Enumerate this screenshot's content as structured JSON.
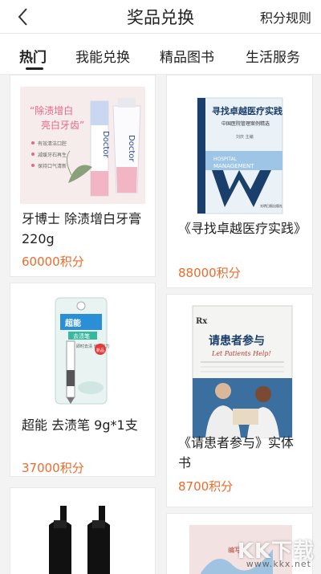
{
  "header": {
    "title": "奖品兑换",
    "rules_label": "积分规则"
  },
  "tabs": [
    {
      "label": "热门"
    },
    {
      "label": "我能兑换"
    },
    {
      "label": "精品图书"
    },
    {
      "label": "生活服务"
    }
  ],
  "products": [
    {
      "name": "牙博士 除渍增白牙膏220g",
      "price": "60000积分",
      "image_text": {
        "slogan_1": "“除渍增白",
        "slogan_2": "亮白牙齿”",
        "brand": "Doctor",
        "bullets": [
          "有效清洁口腔",
          "减缓牙石再生",
          "保持口气清新"
        ]
      }
    },
    {
      "name": "《寻找卓越医疗实践》",
      "price": "88000积分",
      "image_text": {
        "book_title": "寻找卓越医疗实践",
        "subtitle": "中国医院管理案例精选",
        "editor": "刘庆 主编",
        "banner_1": "HOSPITAL",
        "banner_2": "MANAGEMENT",
        "publisher": "光明日报出版社"
      }
    },
    {
      "name": "超能 去渍笔 9g*1支",
      "price": "37000积分",
      "image_text": {
        "brand": "超能",
        "product": "去渍笔",
        "desc": "即时去渍 省水省力",
        "tag": "新品"
      }
    },
    {
      "name": "《请患者参与》实体书",
      "price": "8700积分",
      "image_text": {
        "book_title": "请患者参与",
        "book_sub": "Let Patients Help!",
        "rx": "Rx"
      }
    }
  ],
  "partial_images": {
    "left_bottom": "spray-bottles",
    "right_bottom_label": "编写"
  },
  "watermark": {
    "text": "KK下载",
    "url": "www.kkx.net"
  },
  "colors": {
    "price": "#ec6b2b",
    "background": "#f3f3f3",
    "text": "#222222"
  }
}
